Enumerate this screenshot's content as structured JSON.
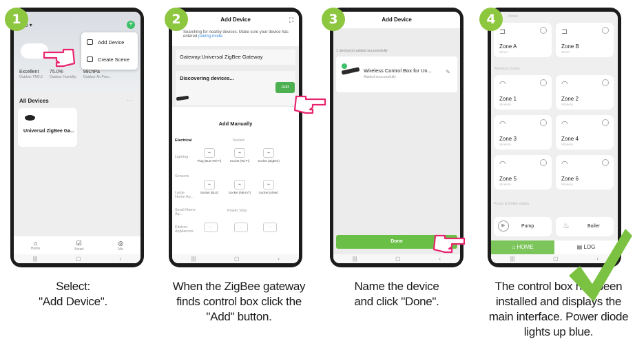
{
  "accent_color": "#8dc63f",
  "steps": [
    {
      "number": "1",
      "caption": [
        "Select:",
        "\"Add Device\"."
      ]
    },
    {
      "number": "2",
      "caption": [
        "When the ZigBee gateway",
        "finds control box click the",
        "\"Add\" button."
      ]
    },
    {
      "number": "3",
      "caption": [
        "Name the device",
        "and click \"Done\"."
      ]
    },
    {
      "number": "4",
      "caption": [
        "The control box has been",
        "installed and displays the",
        "main interface. Power diode",
        "lights up blue."
      ]
    }
  ],
  "screen1": {
    "title": "ligo ▾",
    "menu": {
      "add_device": "Add Device",
      "create_scene": "Create Scene"
    },
    "weather": [
      {
        "value": "Excellent",
        "label": "Outdoor PM2.5"
      },
      {
        "value": "75.0%",
        "label": "Outdoor Humidity"
      },
      {
        "value": "991hPa",
        "label": "Outdoor Air Pres..."
      }
    ],
    "all_devices": "All Devices",
    "device_name": "Universal ZigBee Ga...",
    "tabs": [
      "Home",
      "Smart",
      "Me"
    ]
  },
  "screen2": {
    "title": "Add Device",
    "info": "Searching for nearby devices. Make sure your device has entered",
    "info_link": "pairing mode.",
    "gateway": "Gateway:Universal ZigBee Gateway",
    "discovering": "Discovering devices...",
    "add_button": "Add",
    "add_manually": "Add Manually",
    "category": "Electrical",
    "socket_header": "Socket",
    "rows": [
      "Lighting",
      "Sensors",
      "Large Home Ap...",
      "Small Home Ap...",
      "Kitchen Appliances"
    ],
    "items": [
      {
        "label": "Plug (BLE+Wi-Fi)"
      },
      {
        "label": "Socket (Wi-Fi)"
      },
      {
        "label": "Socket (Zigbee)"
      },
      {
        "label": "Socket (BLE)"
      },
      {
        "label": "Socket (NB-IoT)"
      },
      {
        "label": "Socket (other)"
      }
    ],
    "power_strip": "Power Strip"
  },
  "screen3": {
    "title": "Add Device",
    "subtitle": "1 device(s) added successfully",
    "device_name": "Wireless Control Box for Un...",
    "status": "Added successfully",
    "done_button": "Done"
  },
  "screen4": {
    "header_label": "Zones",
    "wireless_label": "Wireless Zones",
    "pump_section": "Pump & Boiler status",
    "zones": [
      {
        "name": "Zone A",
        "sub": "Wired"
      },
      {
        "name": "Zone B",
        "sub": "Wired"
      },
      {
        "name": "Zone 1",
        "sub": "Wireless"
      },
      {
        "name": "Zone 2",
        "sub": "Wireless"
      },
      {
        "name": "Zone 3",
        "sub": "Wireless"
      },
      {
        "name": "Zone 4",
        "sub": "Wireless"
      },
      {
        "name": "Zone 5",
        "sub": "Wireless"
      },
      {
        "name": "Zone 6",
        "sub": "Wireless"
      }
    ],
    "pump": "Pump",
    "boiler": "Boiler",
    "tab_home": "HOME",
    "tab_log": "LOG"
  }
}
